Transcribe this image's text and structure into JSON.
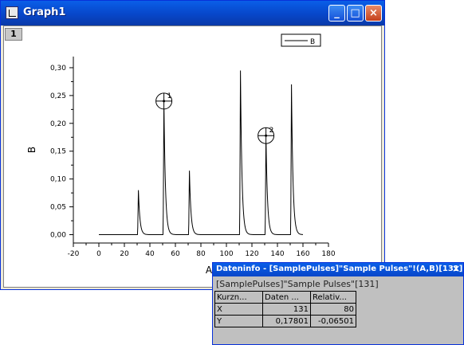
{
  "window": {
    "title": "Graph1",
    "buttons": {
      "minimize": "_",
      "maximize": "□",
      "close": "×"
    },
    "layer_label": "1"
  },
  "chart_data": {
    "type": "line",
    "xlabel": "A",
    "ylabel": "B",
    "xlim": [
      -20,
      180
    ],
    "ylim": [
      -0.015,
      0.32
    ],
    "x_ticks": [
      "-20",
      "0",
      "20",
      "40",
      "60",
      "80",
      "100",
      "120",
      "140",
      "160",
      "180"
    ],
    "y_ticks": [
      "0,00",
      "0,05",
      "0,10",
      "0,15",
      "0,20",
      "0,25",
      "0,30"
    ],
    "legend": {
      "entries": [
        "B"
      ],
      "position": "top-right"
    },
    "series": [
      {
        "name": "B",
        "peaks": [
          {
            "x": 31,
            "height": 0.08
          },
          {
            "x": 51,
            "height": 0.24
          },
          {
            "x": 71,
            "height": 0.115
          },
          {
            "x": 111,
            "height": 0.295
          },
          {
            "x": 131,
            "height": 0.178
          },
          {
            "x": 151,
            "height": 0.27
          }
        ],
        "x_range": [
          0,
          160
        ],
        "baseline": 0
      }
    ],
    "markers": [
      {
        "label": "1",
        "x": 51,
        "y": 0.24
      },
      {
        "label": "2",
        "x": 131,
        "y": 0.178
      }
    ]
  },
  "info": {
    "title": "Dateninfo - [SamplePulses]\"Sample Pulses\"!(A,B)[131]",
    "close": "×",
    "path": "[SamplePulses]\"Sample Pulses\"[131]",
    "headers": [
      "Kurzn...",
      "Daten ...",
      "Relativ..."
    ],
    "rows": [
      [
        "X",
        "131",
        "80"
      ],
      [
        "Y",
        "0,17801",
        "-0,06501"
      ]
    ]
  },
  "colors": {
    "titlebar": "#0746c9",
    "plot_line": "#000000"
  }
}
